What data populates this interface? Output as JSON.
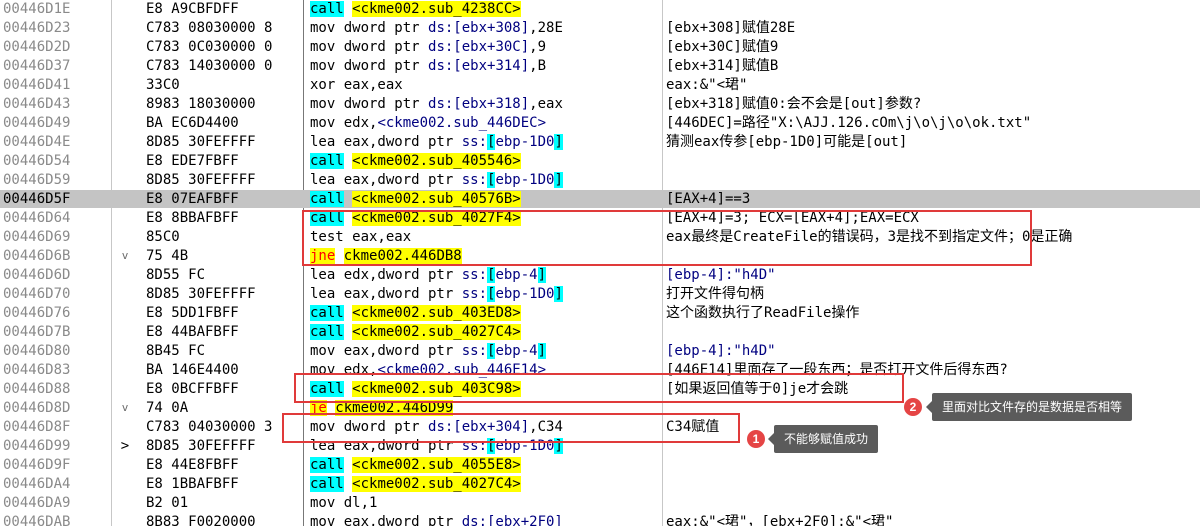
{
  "rows": [
    {
      "addr": "00446D1E",
      "hex": "E8 A9CBFDFF",
      "mark": "",
      "sel": false,
      "dis": [
        {
          "t": "call",
          "k": "call"
        },
        {
          "t": " "
        },
        {
          "t": "<ckme002.sub_4238CC>",
          "k": "tcall"
        }
      ],
      "cmt": []
    },
    {
      "addr": "00446D23",
      "hex": "C783 08030000 8",
      "mark": "",
      "sel": false,
      "dis": [
        {
          "t": "mov dword ptr "
        },
        {
          "t": "ds:[ebx+308]",
          "k": "mem"
        },
        {
          "t": ",28E"
        }
      ],
      "cmt": [
        {
          "t": "[ebx+308]赋值28E"
        }
      ]
    },
    {
      "addr": "00446D2D",
      "hex": "C783 0C030000 0",
      "mark": "",
      "sel": false,
      "dis": [
        {
          "t": "mov dword ptr "
        },
        {
          "t": "ds:[ebx+30C]",
          "k": "mem"
        },
        {
          "t": ",9"
        }
      ],
      "cmt": [
        {
          "t": "[ebx+30C]赋值9"
        }
      ]
    },
    {
      "addr": "00446D37",
      "hex": "C783 14030000 0",
      "mark": "",
      "sel": false,
      "dis": [
        {
          "t": "mov dword ptr "
        },
        {
          "t": "ds:[ebx+314]",
          "k": "mem"
        },
        {
          "t": ",B"
        }
      ],
      "cmt": [
        {
          "t": "[ebx+314]赋值B"
        }
      ]
    },
    {
      "addr": "00446D41",
      "hex": "33C0",
      "mark": "",
      "sel": false,
      "dis": [
        {
          "t": "xor eax,eax"
        }
      ],
      "cmt": [
        {
          "t": "eax:&\"<珺\""
        }
      ]
    },
    {
      "addr": "00446D43",
      "hex": "8983 18030000",
      "mark": "",
      "sel": false,
      "dis": [
        {
          "t": "mov dword ptr "
        },
        {
          "t": "ds:[ebx+318]",
          "k": "mem"
        },
        {
          "t": ",eax"
        }
      ],
      "cmt": [
        {
          "t": "[ebx+318]赋值0:会不会是[out]参数?"
        }
      ]
    },
    {
      "addr": "00446D49",
      "hex": "BA EC6D4400",
      "mark": "",
      "sel": false,
      "dis": [
        {
          "t": "mov edx,"
        },
        {
          "t": "<ckme002.sub_446DEC>",
          "k": "mem"
        }
      ],
      "cmt": [
        {
          "t": "[446DEC]=路径\"X:\\AJJ.126.cOm\\j\\o\\j\\o\\ok.txt\""
        }
      ]
    },
    {
      "addr": "00446D4E",
      "hex": "8D85 30FEFFFF",
      "mark": "",
      "sel": false,
      "dis": [
        {
          "t": "lea eax,dword ptr "
        },
        {
          "t": "ss:",
          "k": "mem"
        },
        {
          "t": "[",
          "k": "br"
        },
        {
          "t": "ebp-1D0",
          "k": "mem"
        },
        {
          "t": "]",
          "k": "br"
        }
      ],
      "cmt": [
        {
          "t": "猜测eax传参[ebp-1D0]可能是[out]"
        }
      ]
    },
    {
      "addr": "00446D54",
      "hex": "E8 EDE7FBFF",
      "mark": "",
      "sel": false,
      "dis": [
        {
          "t": "call",
          "k": "call"
        },
        {
          "t": " "
        },
        {
          "t": "<ckme002.sub_405546>",
          "k": "tcall"
        }
      ],
      "cmt": []
    },
    {
      "addr": "00446D59",
      "hex": "8D85 30FEFFFF",
      "mark": "",
      "sel": false,
      "dis": [
        {
          "t": "lea eax,dword ptr "
        },
        {
          "t": "ss:",
          "k": "mem"
        },
        {
          "t": "[",
          "k": "br"
        },
        {
          "t": "ebp-1D0",
          "k": "mem"
        },
        {
          "t": "]",
          "k": "br"
        }
      ],
      "cmt": []
    },
    {
      "addr": "00446D5F",
      "hex": "E8 07EAFBFF",
      "mark": "",
      "sel": true,
      "dis": [
        {
          "t": "call",
          "k": "call"
        },
        {
          "t": " "
        },
        {
          "t": "<ckme002.sub_40576B>",
          "k": "tcall"
        }
      ],
      "cmt": [
        {
          "t": "[EAX+4]==3"
        }
      ]
    },
    {
      "addr": "00446D64",
      "hex": "E8 8BBAFBFF",
      "mark": "",
      "sel": false,
      "dis": [
        {
          "t": "call",
          "k": "call"
        },
        {
          "t": " "
        },
        {
          "t": "<ckme002.sub_4027F4>",
          "k": "tcall"
        }
      ],
      "cmt": [
        {
          "t": "[EAX+4]=3; ECX=[EAX+4];EAX=ECX"
        }
      ]
    },
    {
      "addr": "00446D69",
      "hex": "85C0",
      "mark": "",
      "sel": false,
      "dis": [
        {
          "t": "test eax,eax"
        }
      ],
      "cmt": [
        {
          "t": "eax最终是CreateFile的错误码，3是找不到指定文件；0是正确"
        }
      ]
    },
    {
      "addr": "00446D6B",
      "hex": "75 4B",
      "mark": "v",
      "sel": false,
      "dis": [
        {
          "t": "jne",
          "k": "jmp"
        },
        {
          "t": " "
        },
        {
          "t": "ckme002.446DB8",
          "k": "tjmp"
        }
      ],
      "cmt": []
    },
    {
      "addr": "00446D6D",
      "hex": "8D55 FC",
      "mark": "",
      "sel": false,
      "dis": [
        {
          "t": "lea edx,dword ptr "
        },
        {
          "t": "ss:",
          "k": "mem"
        },
        {
          "t": "[",
          "k": "br"
        },
        {
          "t": "ebp-4",
          "k": "mem"
        },
        {
          "t": "]",
          "k": "br"
        }
      ],
      "cmt": [
        {
          "t": "[ebp-4]:\"h4D\"",
          "k": "mem"
        }
      ]
    },
    {
      "addr": "00446D70",
      "hex": "8D85 30FEFFFF",
      "mark": "",
      "sel": false,
      "dis": [
        {
          "t": "lea eax,dword ptr "
        },
        {
          "t": "ss:",
          "k": "mem"
        },
        {
          "t": "[",
          "k": "br"
        },
        {
          "t": "ebp-1D0",
          "k": "mem"
        },
        {
          "t": "]",
          "k": "br"
        }
      ],
      "cmt": [
        {
          "t": "打开文件得句柄"
        }
      ]
    },
    {
      "addr": "00446D76",
      "hex": "E8 5DD1FBFF",
      "mark": "",
      "sel": false,
      "dis": [
        {
          "t": "call",
          "k": "call"
        },
        {
          "t": " "
        },
        {
          "t": "<ckme002.sub_403ED8>",
          "k": "tcall"
        }
      ],
      "cmt": [
        {
          "t": "这个函数执行了ReadFile操作"
        }
      ]
    },
    {
      "addr": "00446D7B",
      "hex": "E8 44BAFBFF",
      "mark": "",
      "sel": false,
      "dis": [
        {
          "t": "call",
          "k": "call"
        },
        {
          "t": " "
        },
        {
          "t": "<ckme002.sub_4027C4>",
          "k": "tcall"
        }
      ],
      "cmt": []
    },
    {
      "addr": "00446D80",
      "hex": "8B45 FC",
      "mark": "",
      "sel": false,
      "dis": [
        {
          "t": "mov eax,dword ptr "
        },
        {
          "t": "ss:",
          "k": "mem"
        },
        {
          "t": "[",
          "k": "br"
        },
        {
          "t": "ebp-4",
          "k": "mem"
        },
        {
          "t": "]",
          "k": "br"
        }
      ],
      "cmt": [
        {
          "t": "[ebp-4]:\"h4D\"",
          "k": "mem"
        }
      ]
    },
    {
      "addr": "00446D83",
      "hex": "BA 146E4400",
      "mark": "",
      "sel": false,
      "dis": [
        {
          "t": "mov edx,"
        },
        {
          "t": "<ckme002.sub_446E14>",
          "k": "mem"
        }
      ],
      "cmt": [
        {
          "t": "[446E14]里面存了一段东西；是否打开文件后得东西?"
        }
      ]
    },
    {
      "addr": "00446D88",
      "hex": "E8 0BCFFBFF",
      "mark": "",
      "sel": false,
      "dis": [
        {
          "t": "call",
          "k": "call"
        },
        {
          "t": " "
        },
        {
          "t": "<ckme002.sub_403C98>",
          "k": "tcall"
        }
      ],
      "cmt": [
        {
          "t": "[如果返回值等于0]je才会跳"
        }
      ]
    },
    {
      "addr": "00446D8D",
      "hex": "74 0A",
      "mark": "v",
      "sel": false,
      "dis": [
        {
          "t": "je",
          "k": "jmp"
        },
        {
          "t": " "
        },
        {
          "t": "ckme002.446D99",
          "k": "tjmp"
        }
      ],
      "cmt": []
    },
    {
      "addr": "00446D8F",
      "hex": "C783 04030000 3",
      "mark": "",
      "sel": false,
      "dis": [
        {
          "t": "mov dword ptr "
        },
        {
          "t": "ds:[ebx+304]",
          "k": "mem"
        },
        {
          "t": ",C34"
        }
      ],
      "cmt": [
        {
          "t": "C34赋值"
        }
      ]
    },
    {
      "addr": "00446D99",
      "hex": "8D85 30FEFFFF",
      "mark": ">",
      "sel": false,
      "dis": [
        {
          "t": "lea eax,dword ptr "
        },
        {
          "t": "ss:",
          "k": "mem"
        },
        {
          "t": "[",
          "k": "br"
        },
        {
          "t": "ebp-1D0",
          "k": "mem"
        },
        {
          "t": "]",
          "k": "br"
        }
      ],
      "cmt": []
    },
    {
      "addr": "00446D9F",
      "hex": "E8 44E8FBFF",
      "mark": "",
      "sel": false,
      "dis": [
        {
          "t": "call",
          "k": "call"
        },
        {
          "t": " "
        },
        {
          "t": "<ckme002.sub_4055E8>",
          "k": "tcall"
        }
      ],
      "cmt": []
    },
    {
      "addr": "00446DA4",
      "hex": "E8 1BBAFBFF",
      "mark": "",
      "sel": false,
      "dis": [
        {
          "t": "call",
          "k": "call"
        },
        {
          "t": " "
        },
        {
          "t": "<ckme002.sub_4027C4>",
          "k": "tcall"
        }
      ],
      "cmt": []
    },
    {
      "addr": "00446DA9",
      "hex": "B2 01",
      "mark": "",
      "sel": false,
      "dis": [
        {
          "t": "mov dl,1"
        }
      ],
      "cmt": []
    },
    {
      "addr": "00446DAB",
      "hex": "8B83 F0020000",
      "mark": "",
      "sel": false,
      "dis": [
        {
          "t": "mov eax,dword ptr "
        },
        {
          "t": "ds:[ebx+2F0]",
          "k": "mem"
        }
      ],
      "cmt": [
        {
          "t": "eax:&\"<珺\"，[ebx+2F0]:&\"<珺\""
        }
      ]
    }
  ],
  "annotations": {
    "badge1": "1",
    "tip1": "不能够赋值成功",
    "badge2": "2",
    "tip2": "里面对比文件存的是数据是否相等"
  },
  "colors": {
    "call_bg": "#00FFFF",
    "target_bg": "#FFFF00",
    "jump_text": "#FF0000",
    "selected_row": "#C4C4C4",
    "annotation_red": "#E03A3A"
  }
}
